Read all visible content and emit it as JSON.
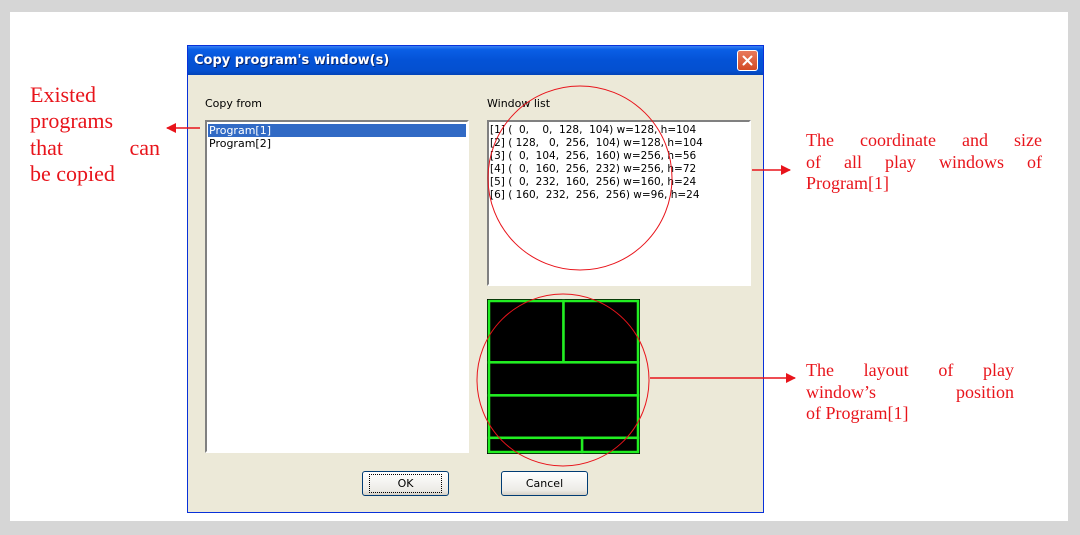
{
  "annotations": {
    "left": [
      "Existed",
      "programs",
      "that can",
      "be copied"
    ],
    "right_top": [
      "The coordinate and size",
      "of all play windows of",
      "Program[1]"
    ],
    "right_bottom": [
      "The layout of play",
      "window’s position",
      "of Program[1]"
    ]
  },
  "dialog": {
    "title": "Copy program's window(s)",
    "copy_from_label": "Copy from",
    "window_list_label": "Window list",
    "programs": [
      {
        "label": "Program[1]",
        "selected": true
      },
      {
        "label": "Program[2]",
        "selected": false
      }
    ],
    "windows": [
      "[1] (  0,    0,  128,  104) w=128, h=104",
      "[2] ( 128,   0,  256,  104) w=128, h=104",
      "[3] (  0,  104,  256,  160) w=256, h=56",
      "[4] (  0,  160,  256,  232) w=256, h=72",
      "[5] (  0,  232,  160,  256) w=160, h=24",
      "[6] ( 160,  232,  256,  256) w=96, h=24"
    ],
    "layout": {
      "canvas_w": 256,
      "canvas_h": 256,
      "rects": [
        [
          0,
          0,
          128,
          104
        ],
        [
          128,
          0,
          256,
          104
        ],
        [
          0,
          104,
          256,
          160
        ],
        [
          0,
          160,
          256,
          232
        ],
        [
          0,
          232,
          160,
          256
        ],
        [
          160,
          232,
          256,
          256
        ]
      ]
    },
    "ok_label": "OK",
    "cancel_label": "Cancel"
  },
  "colors": {
    "annotation": "#e8141b",
    "selection": "#316ac5",
    "window_border": "#22ee22",
    "window_fill": "#000000"
  },
  "icons": {
    "close": "close-x-icon"
  }
}
